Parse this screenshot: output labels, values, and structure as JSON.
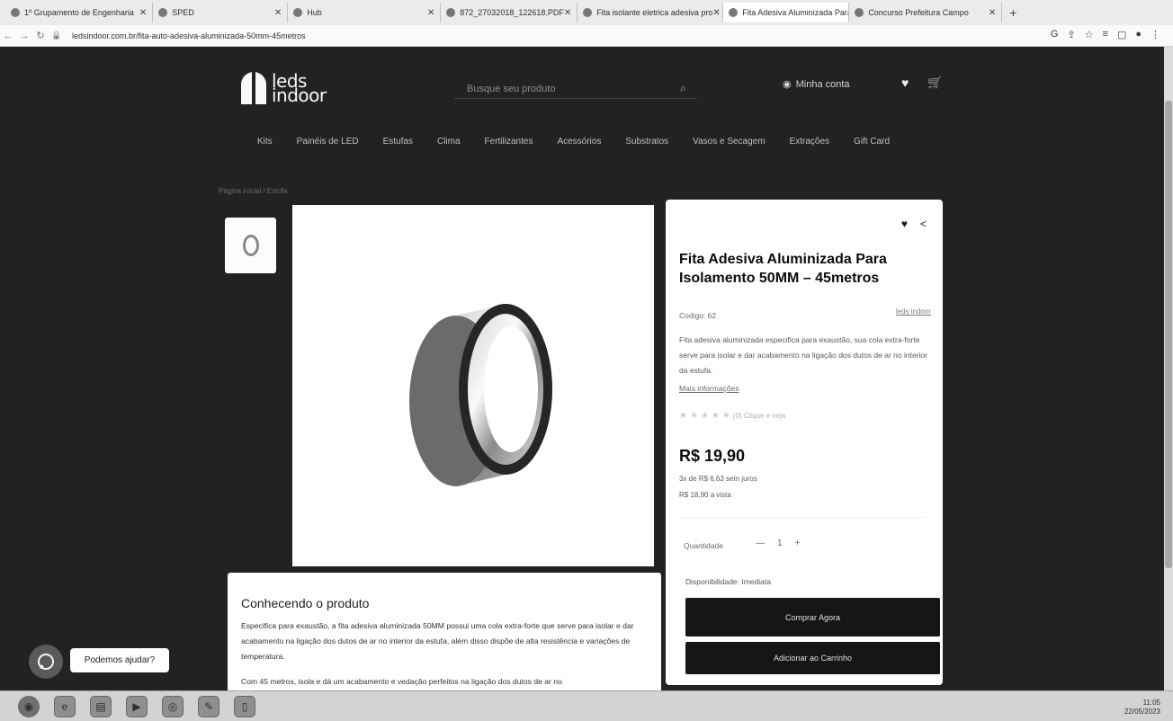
{
  "browser": {
    "tabs": [
      {
        "label": "1º Grupamento de Engenharia"
      },
      {
        "label": "SPED"
      },
      {
        "label": "Hub"
      },
      {
        "label": "872_27032018_122618.PDF"
      },
      {
        "label": "Fita isolante eletrica adesiva pro"
      },
      {
        "label": "Fita Adesiva Aluminizada Para Is"
      },
      {
        "label": "Concurso Prefeitura Campo"
      }
    ],
    "url": "ledsindoor.com.br/fita-auto-adesiva-aluminizada-50mm-45metros"
  },
  "site": {
    "logo_line1": "leds",
    "logo_line2": "indoor",
    "search_placeholder": "Busque seu produto",
    "account_label": "Minha conta",
    "menu": [
      "Kits",
      "Painéis de LED",
      "Estufas",
      "Clima",
      "Fertilizantes",
      "Acessórios",
      "Substratos",
      "Vasos e Secagem",
      "Extrações",
      "Gift Card"
    ],
    "breadcrumb": "Página inicial / Estufa"
  },
  "product": {
    "title": "Fita Adesiva Aluminizada Para Isolamento 50MM – 45metros",
    "code": "Codigo: 62",
    "brand": "leds indoor",
    "description": "Fita adesiva aluminizada especifica para exaustão, sua cola extra-forte serve para isolar e dar acabamento na ligação dos dutos de ar no interior da estufa.",
    "more_info": "Mais informações",
    "rating_text": "(0) Clique e veja",
    "rating": 0,
    "price": "R$ 19,90",
    "installments": "3x de R$ 6,63 sem juros",
    "cash_price": "R$ 18,90 a vista",
    "quantity_label": "Quantidade",
    "quantity": "1",
    "availability": "Disponibilidade: Imediata",
    "buy_label": "Comprar Agora",
    "add_cart_label": "Adicionar ao Carrinho"
  },
  "about": {
    "heading": "Conhecendo o produto",
    "paragraph1": "Especifica para exaustão, a fita adesiva aluminizada 50MM possui uma cola extra-forte que serve para isolar e dar acabamento na ligação dos dutos de ar no interior da estufa, além disso dispõe de alta resistência e variações de temperatura.",
    "paragraph2": "Com 45 metros, isola e dá um acabamento e vedação perfeitos na ligação dos dutos de ar no"
  },
  "whatsapp": {
    "label": "Podemos ajudar?"
  },
  "tray": {
    "time": "11:05",
    "date": "22/05/2023"
  }
}
